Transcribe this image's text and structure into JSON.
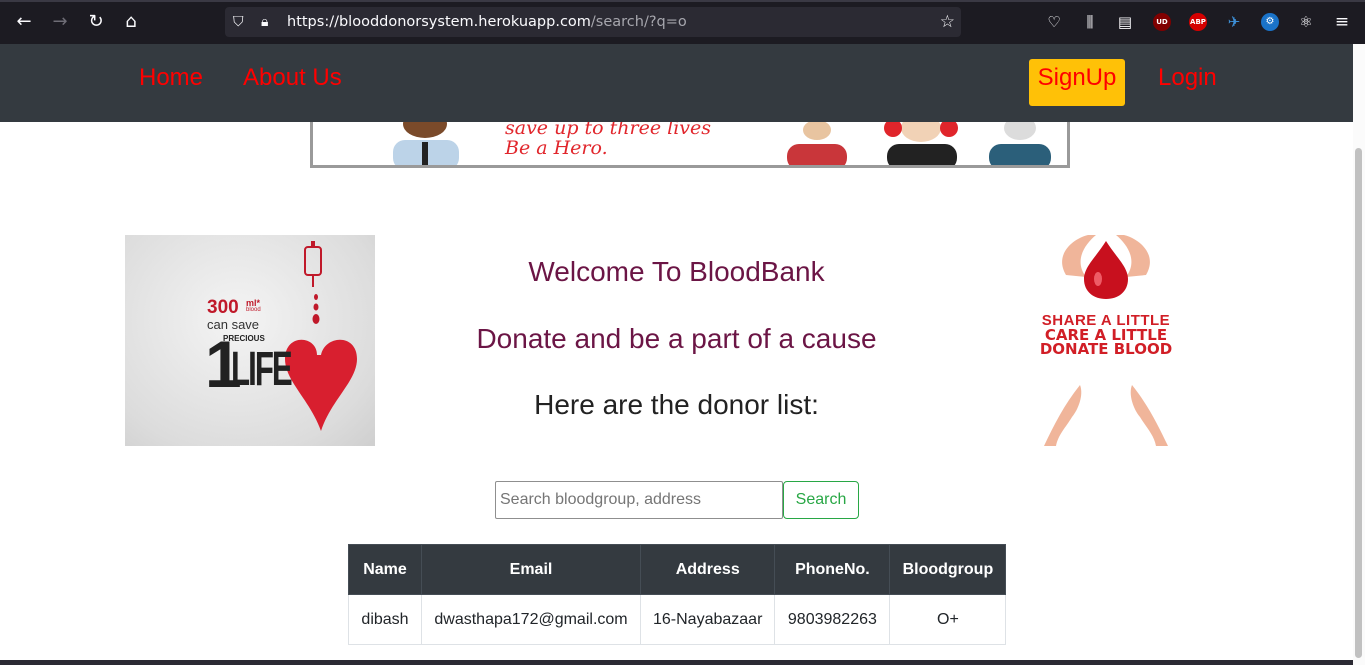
{
  "browser": {
    "url_host": "https://blooddonorsystem.herokuapp.com",
    "url_path": "/search/?q=o",
    "extensions": [
      "pocket-icon",
      "library-icon",
      "sidebar-icon",
      "ublock-icon",
      "adblock-plus-icon",
      "extension-icon",
      "steam-icon",
      "react-devtools-icon",
      "menu-icon"
    ],
    "badges": {
      "ublock": "UD",
      "abp": "ABP"
    }
  },
  "nav": {
    "home": "Home",
    "about": "About Us",
    "signup": "SignUp",
    "login": "Login"
  },
  "banner": {
    "line1": "save up to three lives",
    "line2": "Be a Hero."
  },
  "left_image": {
    "amount": "300",
    "unit": "ml*",
    "unit_sub": "blood",
    "can_save": "can save",
    "one": "1",
    "precious": "PRECIOUS",
    "life": "LIFE"
  },
  "right_image": {
    "line1": "SHARE A LITTLE",
    "line2": "CARE A LITTLE",
    "line3": "DONATE BLOOD"
  },
  "main": {
    "welcome": "Welcome To BloodBank",
    "donate": "Donate and be a part of a cause",
    "donor_list": "Here are the donor list:"
  },
  "search": {
    "placeholder": "Search bloodgroup, address",
    "value": "",
    "button": "Search"
  },
  "table": {
    "headers": [
      "Name",
      "Email",
      "Address",
      "PhoneNo.",
      "Bloodgroup"
    ],
    "rows": [
      [
        "dibash",
        "dwasthapa172@gmail.com",
        "16-Nayabazaar",
        "9803982263",
        "O+"
      ]
    ]
  },
  "colors": {
    "navbar": "#343a40",
    "nav_link": "#ff0000",
    "signup_bg": "#ffc107",
    "heading": "#6b1545",
    "search_button": "#28a745"
  }
}
